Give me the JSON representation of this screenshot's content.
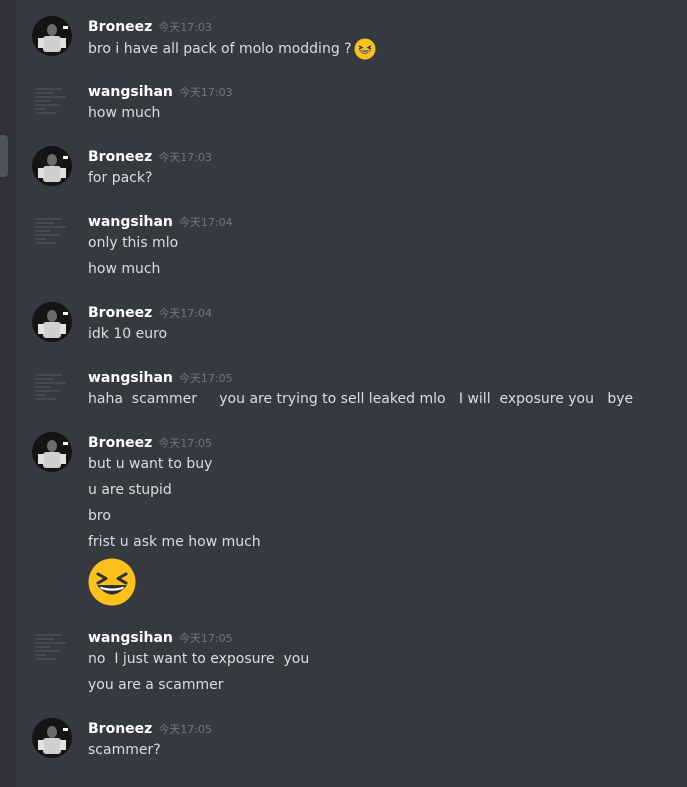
{
  "messages": [
    {
      "author": "Broneez",
      "time": "今天17:03",
      "lines": [
        "bro i have all pack of molo modding ?"
      ],
      "emoji_inline": "grinning-squinting-emoji"
    },
    {
      "author": "wangsihan",
      "time": "今天17:03",
      "lines": [
        "how much"
      ]
    },
    {
      "author": "Broneez",
      "time": "今天17:03",
      "lines": [
        "for pack?"
      ]
    },
    {
      "author": "wangsihan",
      "time": "今天17:04",
      "lines": [
        "only this mlo",
        "how much"
      ]
    },
    {
      "author": "Broneez",
      "time": "今天17:04",
      "lines": [
        "idk 10 euro"
      ]
    },
    {
      "author": "wangsihan",
      "time": "今天17:05",
      "lines": [
        "haha  scammer     you are trying to sell leaked mlo   I will  exposure you   bye"
      ]
    },
    {
      "author": "Broneez",
      "time": "今天17:05",
      "lines": [
        "but u want to buy",
        "u are stupid",
        "bro",
        "frist u ask me how much"
      ],
      "emoji_big": "grinning-squinting-emoji"
    },
    {
      "author": "wangsihan",
      "time": "今天17:05",
      "lines": [
        "no  I just want to exposure  you",
        "you are a scammer"
      ]
    },
    {
      "author": "Broneez",
      "time": "今天17:05",
      "lines": [
        "scammer?"
      ]
    }
  ],
  "colors": {
    "background": "#36393f",
    "sidebar": "#2f3136",
    "author": "#ffffff",
    "timestamp": "#72767d",
    "text": "#dcddde",
    "emoji": "#fcc21b"
  }
}
